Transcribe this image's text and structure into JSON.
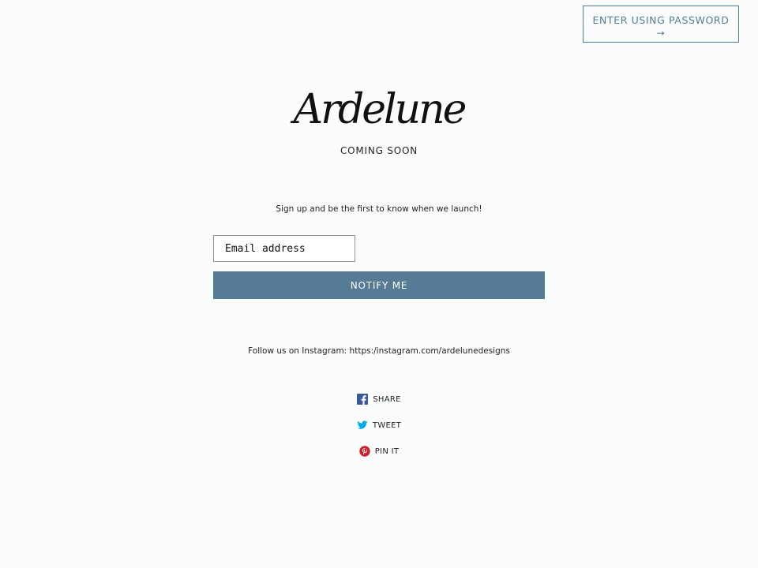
{
  "header": {
    "password_button_label": "ENTER USING PASSWORD",
    "password_button_arrow": "→"
  },
  "brand": {
    "logo_text": "Ardelune",
    "tagline": "COMING SOON"
  },
  "signup": {
    "message": "Sign up and be the first to know when we launch!",
    "email_placeholder": "Email address",
    "email_value": "",
    "submit_label": "NOTIFY ME"
  },
  "social": {
    "follow_text": "Follow us on Instagram: https:/instagram.com/ardelunedesigns",
    "share_items": [
      {
        "label": "SHARE",
        "icon": "facebook-icon"
      },
      {
        "label": "TWEET",
        "icon": "twitter-icon"
      },
      {
        "label": "PIN IT",
        "icon": "pinterest-icon"
      }
    ]
  },
  "colors": {
    "accent": "#557b97",
    "background": "#fbfdfd",
    "text": "#222222",
    "facebook": "#3b5998",
    "twitter": "#00aced",
    "pinterest": "#cb2027"
  }
}
